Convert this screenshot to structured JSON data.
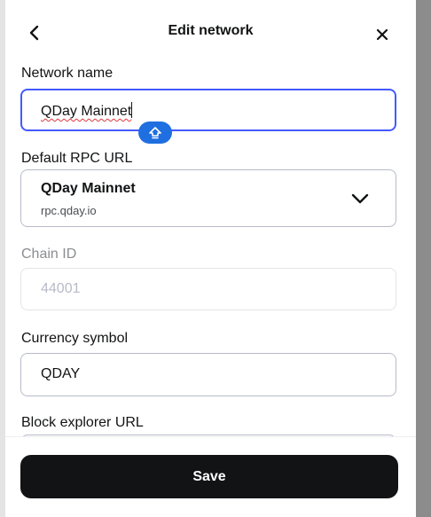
{
  "header": {
    "title": "Edit network",
    "back_icon": "chevron-left-icon",
    "close_icon": "close-icon"
  },
  "form": {
    "network_name": {
      "label": "Network name",
      "value": "QDay Mainnet"
    },
    "rpc": {
      "label": "Default RPC URL",
      "selected_name": "QDay Mainnet",
      "selected_url": "rpc.qday.io"
    },
    "chain_id": {
      "label": "Chain ID",
      "placeholder": "44001"
    },
    "currency": {
      "label": "Currency symbol",
      "value": "QDAY"
    },
    "explorer": {
      "label": "Block explorer URL"
    }
  },
  "footer": {
    "save_label": "Save"
  },
  "colors": {
    "focus_border": "#4459ff",
    "button_bg": "#121314",
    "caps_badge": "#1f6fe0"
  }
}
